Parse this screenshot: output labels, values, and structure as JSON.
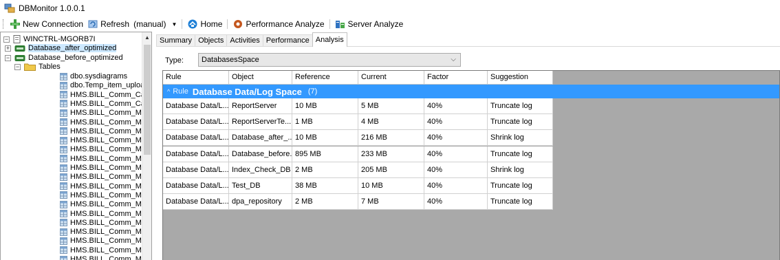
{
  "window": {
    "title": "DBMonitor 1.0.0.1"
  },
  "toolbar": {
    "new_connection": "New Connection",
    "refresh": "Refresh",
    "refresh_mode": "(manual)",
    "home": "Home",
    "performance_analyze": "Performance Analyze",
    "server_analyze": "Server Analyze"
  },
  "tree": {
    "server": "WINCTRL-MGORB7I",
    "databases": [
      "Database_after_optimized",
      "Database_before_optimized"
    ],
    "folder": "Tables",
    "tables": [
      "dbo.sysdiagrams",
      "dbo.Temp_item_uploac",
      "HMS.BILL_Comm_Cas",
      "HMS.BILL_Comm_Cas",
      "HMS.BILL_Comm_MS",
      "HMS.BILL_Comm_MS",
      "HMS.BILL_Comm_MS",
      "HMS.BILL_Comm_MS",
      "HMS.BILL_Comm_MS",
      "HMS.BILL_Comm_MS",
      "HMS.BILL_Comm_MS",
      "HMS.BILL_Comm_MS",
      "HMS.BILL_Comm_MS",
      "HMS.BILL_Comm_MS",
      "HMS.BILL_Comm_MS",
      "HMS.BILL_Comm_MS",
      "HMS.BILL_Comm_MS",
      "HMS.BILL_Comm_MS",
      "HMS.BILL_Comm_MS",
      "HMS.BILL_Comm_MS",
      "HMS.BILL_Comm_MS",
      "HMS.BILL_Comm_MS"
    ]
  },
  "tabs": [
    "Summary",
    "Objects",
    "Activities",
    "Performance",
    "Analysis"
  ],
  "active_tab": "Analysis",
  "analysis": {
    "type_label": "Type:",
    "type_value": "DatabasesSpace",
    "columns": [
      "Rule",
      "Object",
      "Reference",
      "Current",
      "Factor",
      "Suggestion"
    ],
    "group": {
      "prefix": "Rule",
      "name": "Database Data/Log Space",
      "count": "(7)"
    },
    "rows": [
      [
        "Database Data/L...",
        "ReportServer",
        "10 MB",
        "5 MB",
        "40%",
        "Truncate log"
      ],
      [
        "Database Data/L...",
        "ReportServerTe...",
        "1 MB",
        "4 MB",
        "40%",
        "Truncate log"
      ],
      [
        "Database Data/L...",
        "Database_after_...",
        "10 MB",
        "216 MB",
        "40%",
        "Shrink log"
      ],
      [
        "Database Data/L...",
        "Database_before...",
        "895 MB",
        "233 MB",
        "40%",
        "Truncate log"
      ],
      [
        "Database Data/L...",
        "Index_Check_DB",
        "2 MB",
        "205 MB",
        "40%",
        "Shrink log"
      ],
      [
        "Database Data/L...",
        "Test_DB",
        "38 MB",
        "10 MB",
        "40%",
        "Truncate log"
      ],
      [
        "Database Data/L...",
        "dpa_repository",
        "2 MB",
        "7 MB",
        "40%",
        "Truncate log"
      ]
    ]
  },
  "colors": {
    "selection": "#cce8ff",
    "group_row": "#3399ff",
    "grid_background": "#a9a9a9"
  }
}
